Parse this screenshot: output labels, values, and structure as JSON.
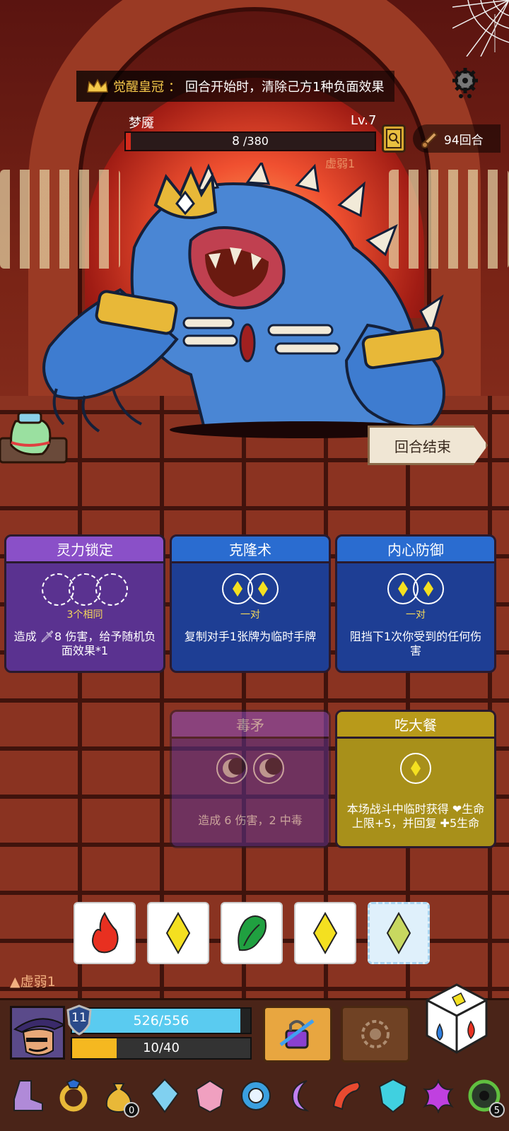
{
  "buff_banner": {
    "name": "觉醒皇冠",
    "separator": "：",
    "desc": "回合开始时，清除己方1种负面效果"
  },
  "boss": {
    "name": "梦魇",
    "level": "Lv.7",
    "hp_current": "8",
    "hp_max": " /380",
    "hp_fraction": 0.021,
    "status": "虚弱1"
  },
  "turns": {
    "label": "94回合"
  },
  "end_turn": {
    "label": "回合结束"
  },
  "cards": [
    {
      "title": "灵力锁定",
      "condition": "3个相同",
      "desc": "造成 🗡8 伤害，给予随机负面效果*1",
      "color": "purple"
    },
    {
      "title": "克隆术",
      "condition": "一对",
      "desc": "复制对手1张牌为临时手牌",
      "color": "blue"
    },
    {
      "title": "内心防御",
      "condition": "一对",
      "desc": "阻挡下1次你受到的任何伤害",
      "color": "blue"
    },
    {
      "title": "毒矛",
      "condition": "",
      "desc": "造成 6 伤害，2 中毒",
      "color": "purple"
    },
    {
      "title": "吃大餐",
      "condition": "",
      "desc": "本场战斗中临时获得 ❤生命上限+5，并回复 ✚5生命",
      "color": "yellow"
    }
  ],
  "dice_hand": [
    "fire",
    "diamond",
    "leaf",
    "diamond",
    "diamond-frozen"
  ],
  "player": {
    "status": "虚弱1",
    "shield": "11",
    "hp": "526/556",
    "hp_fraction": 0.946,
    "energy": "10/40",
    "energy_fraction": 0.25
  },
  "relics": [
    {
      "icon": "boot-icon"
    },
    {
      "icon": "ring-icon"
    },
    {
      "icon": "money-bag-icon",
      "count": "0"
    },
    {
      "icon": "crystal-icon"
    },
    {
      "icon": "gem-icon"
    },
    {
      "icon": "compass-ring-icon"
    },
    {
      "icon": "moon-icon"
    },
    {
      "icon": "horn-icon"
    },
    {
      "icon": "shield-gem-icon"
    },
    {
      "icon": "splash-icon"
    },
    {
      "icon": "green-orb-icon",
      "count": "5"
    }
  ],
  "colors": {
    "accent_gold": "#f4c84a",
    "hp_blue": "#5acbf0",
    "energy_yellow": "#f5b820",
    "boss_hp_red": "#d42a1c"
  }
}
